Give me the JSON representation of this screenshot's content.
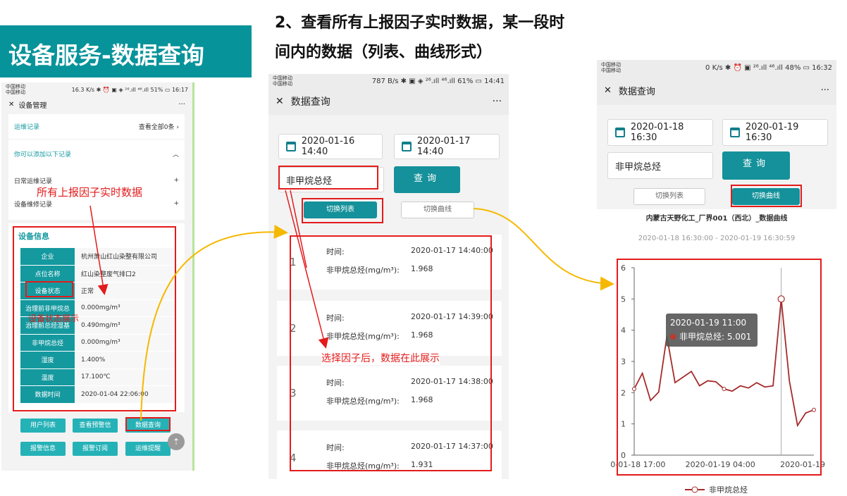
{
  "title": "设备服务-数据查询",
  "heading_line1": "2、查看所有上报因子实时数据，某一段时",
  "heading_line2": "间内的数据（列表、曲线形式）",
  "phone1": {
    "carrier1": "中国移动",
    "carrier2": "中国移动",
    "status": "16.3 K/s ✱ ⏰ ▣ ◈ ²⁶.ıll ⁴⁶.ıll 51% ▭ 16:17",
    "nav_title": "设备管理",
    "more": "···",
    "ops_record": "运维记录",
    "view_all": "查看全部0条",
    "can_add": "你可以添加以下记录",
    "daily_ops": "日常运维记录",
    "maint": "设备维修记录",
    "plus": "+",
    "device_info": "设备信息",
    "rows": [
      {
        "k": "企业",
        "v": "杭州萧山红山染整有限公司"
      },
      {
        "k": "点位名称",
        "v": "红山染整废气排口2"
      },
      {
        "k": "设备状态",
        "v": "正常"
      },
      {
        "k": "治理前非甲烷总",
        "v": "0.000mg/m³"
      },
      {
        "k": "治理前总烃湿基",
        "v": "0.490mg/m³"
      },
      {
        "k": "非甲烷总烃",
        "v": "0.000mg/m³"
      },
      {
        "k": "湿度",
        "v": "1.400%"
      },
      {
        "k": "温度",
        "v": "17.100℃"
      },
      {
        "k": "数据时间",
        "v": "2020-01-04 22:06:00"
      }
    ],
    "buttons": [
      "用户列表",
      "查看预警信",
      "数据查询",
      "报警信息",
      "报警订阅",
      "运维提醒"
    ],
    "annotation_realtime": "所有上报因子实时数据",
    "annotation_status": "设备状态展示"
  },
  "phone2": {
    "carrier1": "中国移动",
    "carrier2": "中国移动",
    "status": "787 B/s ✱ ▣ ◈ ²⁶.ıll ⁴⁶.ıll 61% ▭ 14:41",
    "nav_title": "数据查询",
    "more": "···",
    "start_date": "2020-01-16 14:40",
    "end_date": "2020-01-17 14:40",
    "factor": "非甲烷总烃",
    "query": "查询",
    "switch_list": "切换列表",
    "switch_curve": "切换曲线",
    "time_label": "时间:",
    "value_label": "非甲烷总烃(mg/m³):",
    "items": [
      {
        "num": "1",
        "time": "2020-01-17 14:40:00",
        "value": "1.968"
      },
      {
        "num": "2",
        "time": "2020-01-17 14:39:00",
        "value": "1.968"
      },
      {
        "num": "3",
        "time": "2020-01-17 14:38:00",
        "value": "1.968"
      },
      {
        "num": "4",
        "time": "2020-01-17 14:37:00",
        "value": "1.931"
      }
    ],
    "annotation": "选择因子后，数据在此展示"
  },
  "phone3": {
    "carrier1": "中国移动",
    "carrier2": "中国移动",
    "status": "0 K/s ✱ ⏰ ▣ ²⁶.ıll ⁴⁶.ıll 48% ▭ 16:32",
    "nav_title": "数据查询",
    "more": "···",
    "start_date": "2020-01-18 16:30",
    "end_date": "2020-01-19 16:30",
    "factor": "非甲烷总烃",
    "query": "查询",
    "switch_list": "切换列表",
    "switch_curve": "切换曲线"
  },
  "chart_data": {
    "type": "line",
    "title": "内蒙古天野化工_厂界001（西北）_数据曲线",
    "subtitle": "2020-01-18 16:30:00 - 2020-01-19 16:30:59",
    "ylim": [
      0,
      6
    ],
    "yticks": [
      "0",
      "1",
      "2",
      "3",
      "4",
      "5",
      "6"
    ],
    "xticks": [
      "0-01-18 17:00",
      "2020-01-19 04:00",
      "2020-01-19"
    ],
    "xtick_hours": [
      0.5,
      11.5,
      22.5
    ],
    "x": [
      0,
      1,
      2,
      3,
      4,
      5,
      6,
      7,
      8,
      9,
      10,
      11,
      12,
      13,
      14,
      15,
      16,
      17,
      18,
      19,
      20,
      21,
      22,
      23,
      24
    ],
    "series": [
      {
        "name": "非甲烷总烃",
        "color": "#a62a2a",
        "values": [
          2.12,
          2.62,
          1.75,
          2.02,
          3.8,
          2.32,
          2.5,
          2.68,
          2.22,
          2.38,
          2.35,
          2.12,
          2.05,
          2.22,
          2.15,
          2.32,
          2.18,
          2.22,
          5.0,
          2.38,
          0.95,
          1.35,
          1.45
        ]
      }
    ],
    "tooltip": {
      "time": "2020-01-19 11:00",
      "label": "非甲烷总烃: 5.001"
    },
    "legend": "非甲烷总烃",
    "accent": "#e31b1b",
    "arrow_color": "#f5b800"
  }
}
